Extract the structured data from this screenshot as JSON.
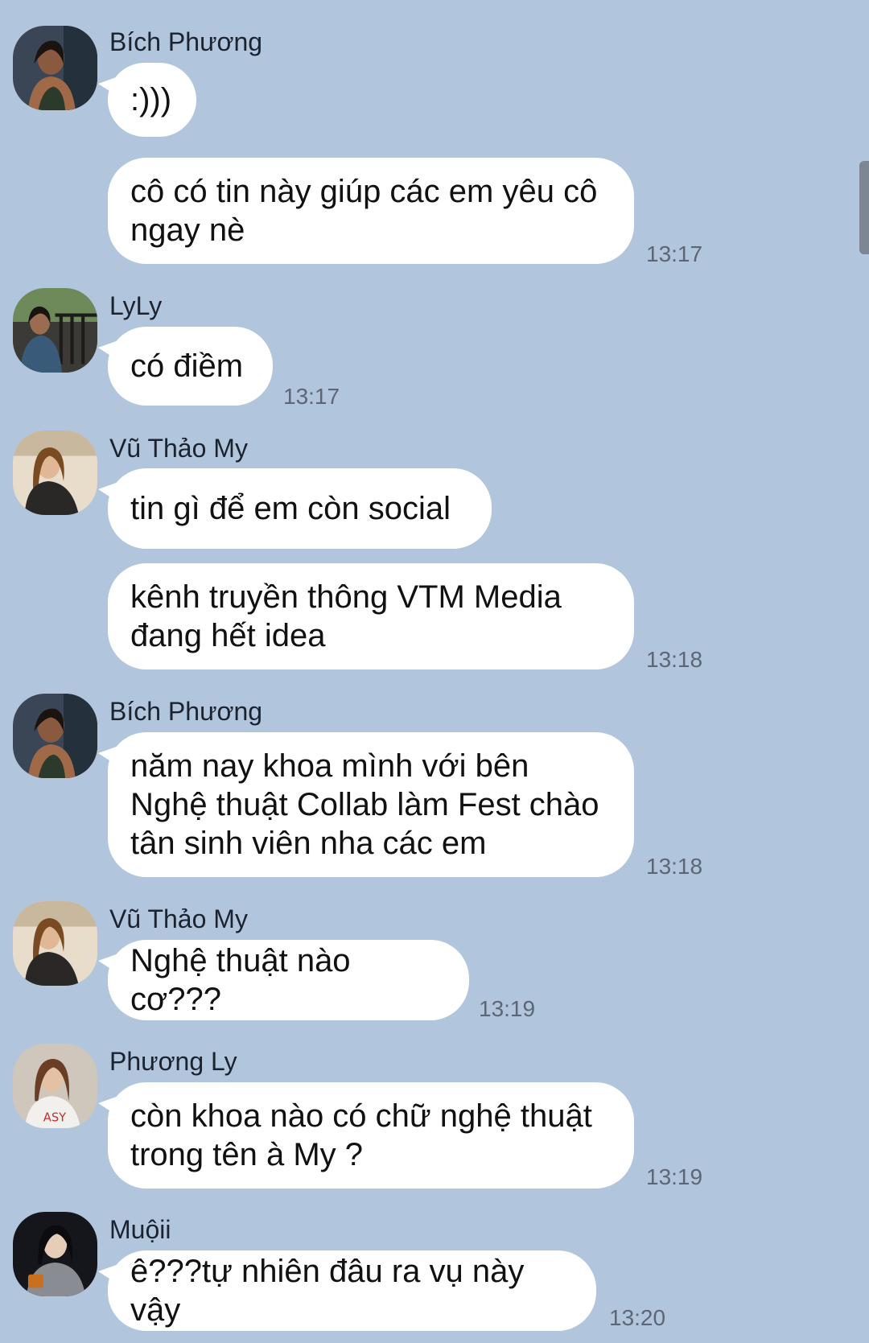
{
  "messages": [
    {
      "sender": "Bích Phương",
      "text": ":)))",
      "time": ""
    },
    {
      "sender": "",
      "text": "cô có tin này giúp các em yêu cô ngay nè",
      "time": "13:17"
    },
    {
      "sender": "LyLy",
      "text": "có điềm",
      "time": "13:17"
    },
    {
      "sender": "Vũ Thảo My",
      "text": "tin gì để em còn social",
      "time": ""
    },
    {
      "sender": "",
      "text": "kênh truyền thông VTM Media đang hết idea",
      "time": "13:18"
    },
    {
      "sender": "Bích Phương",
      "text": "năm nay khoa mình với bên Nghệ thuật Collab làm Fest chào tân sinh viên nha các em",
      "time": "13:18"
    },
    {
      "sender": "Vũ Thảo My",
      "text": "Nghệ thuật nào cơ???",
      "time": "13:19"
    },
    {
      "sender": "Phương Ly",
      "text": "còn khoa nào có chữ nghệ thuật trong tên à My ?",
      "time": "13:19"
    },
    {
      "sender": "Muộii",
      "text": "ê???tự nhiên đâu ra vụ này vậy",
      "time": "13:20"
    }
  ],
  "colors": {
    "background": "#b1c6dc",
    "bubble": "#ffffff",
    "timestamp": "#5d6675"
  }
}
